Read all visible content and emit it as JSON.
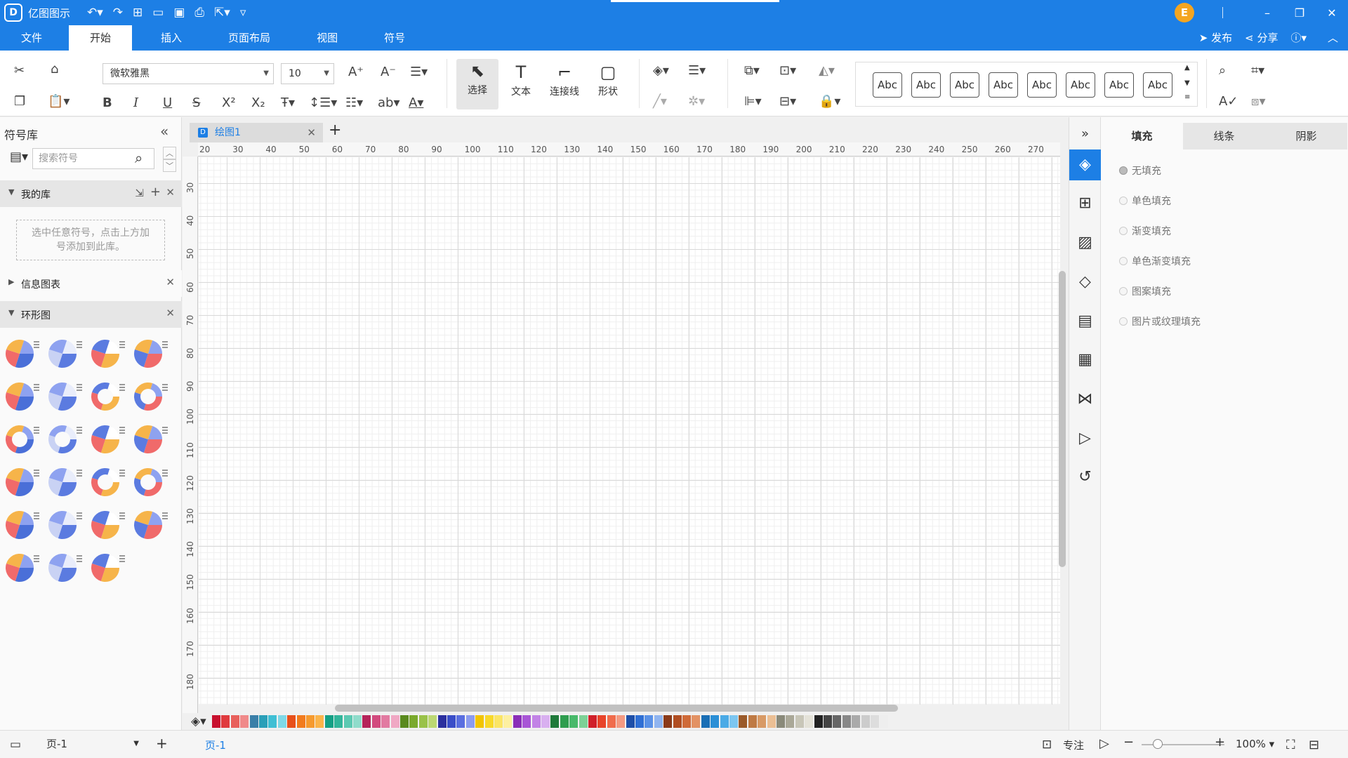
{
  "app": {
    "name": "亿图图示",
    "logo": "D"
  },
  "titlebar": {
    "avatar_letter": "E"
  },
  "menu": {
    "items": [
      "文件",
      "开始",
      "插入",
      "页面布局",
      "视图",
      "符号"
    ],
    "active": "开始",
    "publish": "发布",
    "share": "分享"
  },
  "ribbon": {
    "font_name": "微软雅黑",
    "font_size": "10",
    "tools": {
      "select": "选择",
      "text": "文本",
      "connector": "连接线",
      "shape": "形状"
    },
    "style_samples": [
      "Abc",
      "Abc",
      "Abc",
      "Abc",
      "Abc",
      "Abc",
      "Abc",
      "Abc"
    ]
  },
  "library": {
    "title": "符号库",
    "search_placeholder": "搜索符号",
    "sections": {
      "my_lib": "我的库",
      "my_lib_hint_line1": "选中任意符号，点击上方加",
      "my_lib_hint_line2": "号添加到此库。",
      "info_chart": "信息图表",
      "donut": "环形图"
    }
  },
  "document": {
    "tab_name": "绘图1",
    "h_ruler": [
      "20",
      "30",
      "40",
      "50",
      "60",
      "70",
      "80",
      "90",
      "100",
      "110",
      "120",
      "130",
      "140",
      "150",
      "160",
      "170",
      "180",
      "190",
      "200",
      "210",
      "220",
      "230",
      "240",
      "250",
      "260",
      "270"
    ],
    "v_ruler": [
      "30",
      "40",
      "50",
      "60",
      "70",
      "80",
      "90",
      "100",
      "110",
      "120",
      "130",
      "140",
      "150",
      "160",
      "170",
      "180"
    ]
  },
  "palette": [
    "#c8102e",
    "#e03a3e",
    "#e8605c",
    "#f08a8a",
    "#3a7fa8",
    "#2a9fb8",
    "#3fbfd4",
    "#7fd8e6",
    "#e8501a",
    "#f27b1d",
    "#f69a2e",
    "#fbb44a",
    "#14a085",
    "#32b59a",
    "#5cc9b2",
    "#8fdccb",
    "#b5245a",
    "#d24a7e",
    "#e27aa1",
    "#f0a8c4",
    "#5a8a1e",
    "#7aa92c",
    "#99c248",
    "#bcd873",
    "#2b2f9e",
    "#3a4ec8",
    "#5a6fe0",
    "#8b9bef",
    "#f2c400",
    "#f8d92a",
    "#fbe565",
    "#fdf0a0",
    "#8a2eb8",
    "#a855d6",
    "#c283e6",
    "#d9b0f0",
    "#1f7a3a",
    "#2e9d4e",
    "#48b96a",
    "#7dd196",
    "#d0202a",
    "#e8442a",
    "#f06c4c",
    "#f49a82",
    "#1e4fa8",
    "#2f6fd4",
    "#5a91e6",
    "#8fb4f0",
    "#8a3a1a",
    "#b04e22",
    "#cf6a38",
    "#e39264",
    "#1a6fb5",
    "#2a8fd6",
    "#4aaae6",
    "#7cc6f0",
    "#9a5a2a",
    "#bf7a44",
    "#d89a66",
    "#ebbf94",
    "#8a8a7a",
    "#aaa898",
    "#c8c6b8",
    "#e4e2d8",
    "#222222",
    "#444444",
    "#666666",
    "#888888",
    "#aaaaaa",
    "#cccccc",
    "#dddddd",
    "#eeeeee"
  ],
  "panels": {
    "tabs": [
      "填充",
      "线条",
      "阴影"
    ],
    "active": "填充",
    "fill_options": [
      "无填充",
      "单色填充",
      "渐变填充",
      "单色渐变填充",
      "图案填充",
      "图片或纹理填充"
    ]
  },
  "status": {
    "page_select": "页-1",
    "page_tab": "页-1",
    "focus": "专注",
    "zoom": "100%"
  }
}
